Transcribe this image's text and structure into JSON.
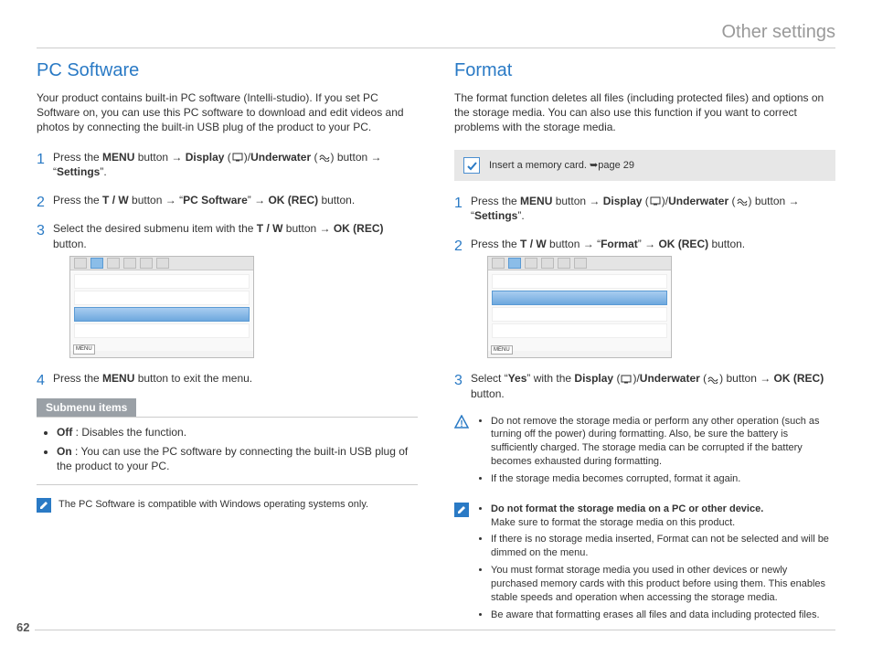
{
  "page": {
    "header": "Other settings",
    "number": "62"
  },
  "left": {
    "title": "PC Software",
    "intro": "Your product contains built-in PC software (Intelli-studio). If you set PC Software on, you can use this PC software to download and edit videos and photos by connecting the built-in USB plug of the product to your PC.",
    "step1_a": "Press the ",
    "step1_menu": "MENU",
    "step1_b": " button ",
    "step1_display": "Display",
    "step1_underwater": "Underwater",
    "step1_c": " button ",
    "step1_settings": "Settings",
    "step2_a": "Press the ",
    "step2_tw": "T / W",
    "step2_b": " button ",
    "step2_pcsoft": "PC Software",
    "step2_okrec": "OK (REC)",
    "step2_c": " button.",
    "step3_a": "Select the desired submenu item with the ",
    "step3_tw": "T / W",
    "step3_b": " button ",
    "step3_okrec": "OK (REC)",
    "step3_c": " button.",
    "ui_menu": "MENU",
    "step4_a": "Press the ",
    "step4_menu": "MENU",
    "step4_b": " button to exit the menu.",
    "submenu_header": "Submenu items",
    "sub_off_label": "Off",
    "sub_off_desc": " : Disables the function.",
    "sub_on_label": "On",
    "sub_on_desc": " : You can use the PC software by connecting the built-in USB plug of the product to your PC.",
    "note": "The PC Software is compatible with Windows operating systems only."
  },
  "right": {
    "title": "Format",
    "intro": "The format function deletes all files (including protected files) and options on the storage media. You can also use this function if you want to correct problems with the storage media.",
    "callout": "Insert a memory card. ",
    "callout_ref": "page 29",
    "step1_a": "Press the ",
    "step1_menu": "MENU",
    "step1_b": " button ",
    "step1_display": "Display",
    "step1_underwater": "Underwater",
    "step1_c": " button ",
    "step1_settings": "Settings",
    "step2_a": "Press the ",
    "step2_tw": "T / W",
    "step2_b": " button ",
    "step2_format": "Format",
    "step2_okrec": "OK (REC)",
    "step2_c": " button.",
    "ui_menu": "MENU",
    "step3_a": "Select “",
    "step3_yes": "Yes",
    "step3_b": "” with the ",
    "step3_display": "Display",
    "step3_underwater": "Underwater",
    "step3_c": " button ",
    "step3_okrec": "OK (REC)",
    "step3_d": " button.",
    "warn1": "Do not remove the storage media or perform any other operation (such as turning off the power) during formatting. Also, be sure the battery is sufficiently charged. The storage media can be corrupted if the battery becomes exhausted during formatting.",
    "warn2": "If the storage media becomes corrupted, format it again.",
    "info1_bold": "Do not format the storage media on a PC or other device.",
    "info1_rest": "Make sure to format the storage media on this product.",
    "info2": "If there is no storage media inserted, Format can not be selected and will be dimmed on the menu.",
    "info3": "You must format storage media you used in other devices or newly purchased memory cards with this product before using them. This enables stable speeds and operation when accessing the storage media.",
    "info4": "Be aware that formatting erases all files and data including protected files."
  }
}
